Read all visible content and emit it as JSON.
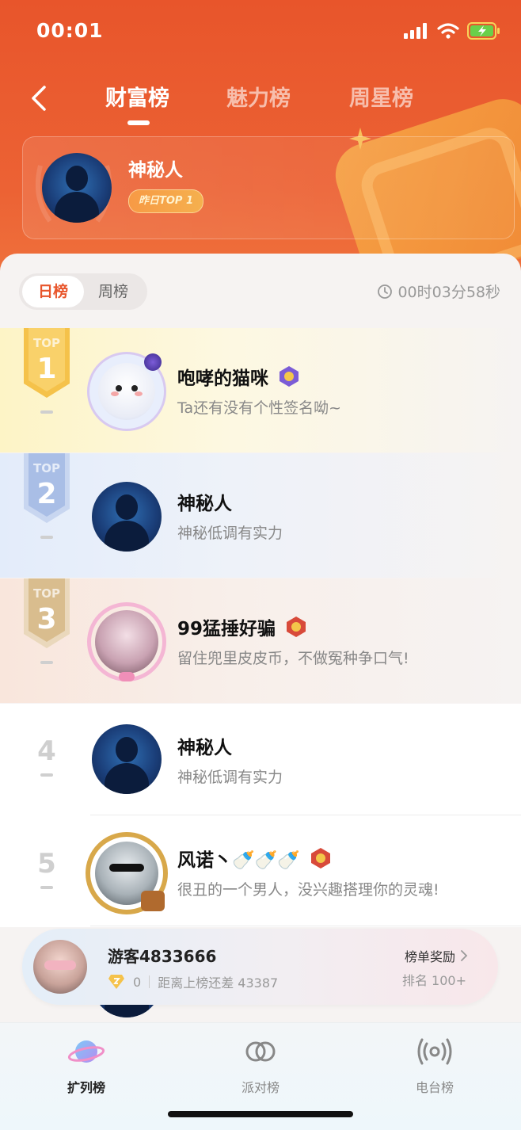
{
  "status_bar": {
    "time": "00:01"
  },
  "nav": {
    "tabs": [
      {
        "label": "财富榜",
        "active": true
      },
      {
        "label": "魅力榜",
        "active": false
      },
      {
        "label": "周星榜",
        "active": false
      }
    ]
  },
  "top_card": {
    "name": "神秘人",
    "badge": "昨日TOP 1"
  },
  "period": {
    "options": [
      "日榜",
      "周榜"
    ],
    "selected": "日榜",
    "countdown": "00时03分58秒"
  },
  "rankings": [
    {
      "rank": "1",
      "medal_label": "TOP",
      "name": "咆哮的猫咪",
      "signature": "Ta还有没有个性签名呦~",
      "level_color": "#7b5cd6"
    },
    {
      "rank": "2",
      "medal_label": "TOP",
      "name": "神秘人",
      "signature": "神秘低调有实力"
    },
    {
      "rank": "3",
      "medal_label": "TOP",
      "name": "99猛捶好骗",
      "signature": "留住兜里皮皮币，不做冤种争口气!",
      "level_color": "#d84a3a"
    },
    {
      "rank": "4",
      "name": "神秘人",
      "signature": "神秘低调有实力"
    },
    {
      "rank": "5",
      "name": "风诺丶🍼🍼🍼",
      "signature": "很丑的一个男人，没兴趣搭理你的灵魂!",
      "level_color": "#d84a3a"
    }
  ],
  "my_card": {
    "name": "游客4833666",
    "coins": "0",
    "gap_text": "距离上榜还差 43387",
    "reward_label": "榜单奖励",
    "rank_text": "排名 100+"
  },
  "bottom_nav": [
    {
      "label": "扩列榜",
      "icon": "planet-icon",
      "active": true
    },
    {
      "label": "派对榜",
      "icon": "link-rings-icon",
      "active": false
    },
    {
      "label": "电台榜",
      "icon": "radio-broadcast-icon",
      "active": false
    }
  ],
  "colors": {
    "brand": "#e8552b",
    "gold": "#f5c24a",
    "silver": "#9fb7e6",
    "bronze": "#d8b88c"
  }
}
